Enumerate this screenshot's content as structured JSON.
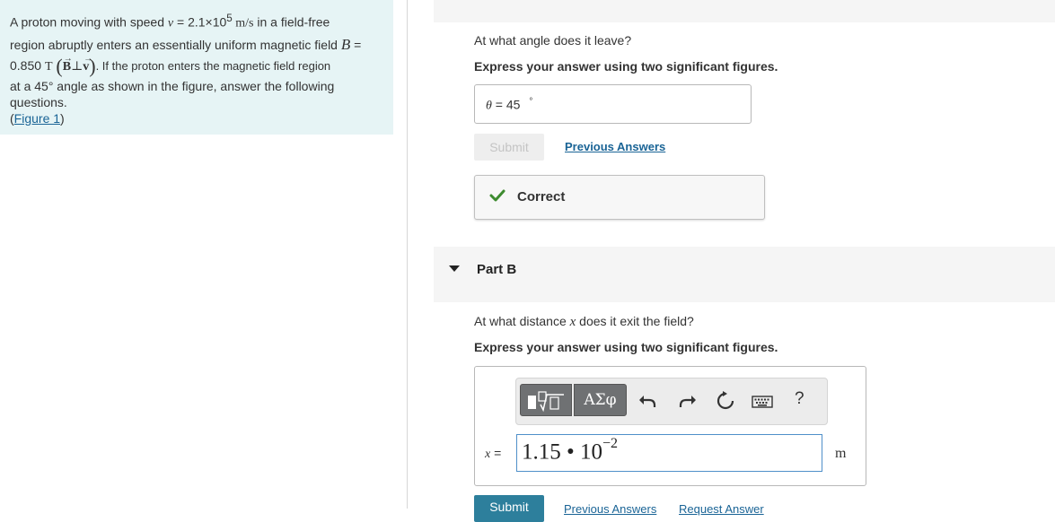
{
  "problem": {
    "l1_a": "A proton moving with speed ",
    "l1_v": "v",
    "l1_eq": " = 2.1×10",
    "l1_exp": "5",
    "l1_unit": " m/s",
    "l1_b": " in a field-free",
    "l2_a": "region abruptly enters an essentially uniform magnetic field ",
    "l2_B": "B",
    "l2_eq": " =",
    "l3_val": "0.850 ",
    "l3_T": "T",
    "l3_Bvec": "B",
    "l3_perp": "⊥",
    "l3_vvec": "v",
    "l3_rest": ". If the proton enters the magnetic field region",
    "l4": "at a 45° angle as shown in the figure, answer the following",
    "l5": "questions.",
    "figure_link": "Figure 1"
  },
  "part_a": {
    "question": "At what angle does it leave?",
    "instruction": "Express your answer using two significant figures.",
    "answer_var": "θ",
    "answer_eq": " = ",
    "answer_value": "45",
    "answer_unit": "°",
    "submit_label": "Submit",
    "previous_answers_label": "Previous Answers",
    "feedback_label": "Correct"
  },
  "part_b": {
    "title": "Part B",
    "question_a": "At what distance ",
    "question_var": "x",
    "question_b": " does it exit the field?",
    "instruction": "Express your answer using two significant figures.",
    "toolbar_greek": "ΑΣφ",
    "toolbar_help": "?",
    "answer_var": "x",
    "answer_eq": " =",
    "answer_mantissa": "1.15 • 10",
    "answer_exponent": "−2",
    "unit": "m",
    "submit_label": "Submit",
    "previous_answers_label": "Previous Answers",
    "request_answer_label": "Request Answer"
  },
  "colors": {
    "problem_bg": "#e6f4f5",
    "link": "#1a6496",
    "correct_check": "#3d8b2f",
    "submit_active": "#2d7f9c"
  }
}
